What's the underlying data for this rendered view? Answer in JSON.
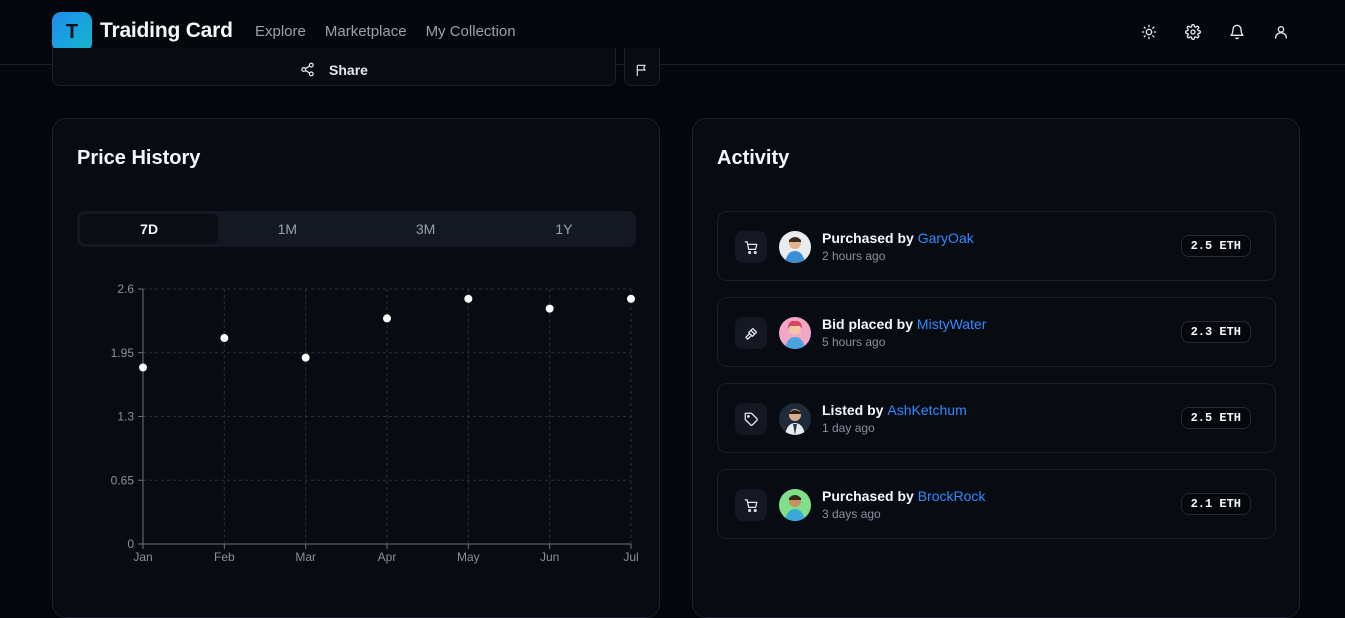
{
  "header": {
    "logo_letter": "T",
    "brand": "Traiding Card",
    "nav": [
      "Explore",
      "Marketplace",
      "My Collection"
    ],
    "icons": [
      "sun-icon",
      "gear-icon",
      "bell-icon",
      "user-icon"
    ]
  },
  "actions": {
    "share_label": "Share"
  },
  "price_history": {
    "title": "Price History",
    "ranges": [
      "7D",
      "1M",
      "3M",
      "1Y"
    ],
    "active_range": "7D"
  },
  "chart_data": {
    "type": "scatter",
    "categories": [
      "Jan",
      "Feb",
      "Mar",
      "Apr",
      "May",
      "Jun",
      "Jul"
    ],
    "values": [
      1.8,
      2.1,
      1.9,
      2.3,
      2.5,
      2.4,
      2.5
    ],
    "yticks": [
      "0",
      "0.65",
      "1.3",
      "1.95",
      "2.6"
    ],
    "ylim": [
      0,
      2.6
    ],
    "grid": true,
    "point_color": "#ffffff"
  },
  "activity": {
    "title": "Activity",
    "items": [
      {
        "action": "Purchased by",
        "user": "GaryOak",
        "time": "2 hours ago",
        "price": "2.5 ETH",
        "icon": "cart-icon"
      },
      {
        "action": "Bid placed by",
        "user": "MistyWater",
        "time": "5 hours ago",
        "price": "2.3 ETH",
        "icon": "gavel-icon"
      },
      {
        "action": "Listed by",
        "user": "AshKetchum",
        "time": "1 day ago",
        "price": "2.5 ETH",
        "icon": "tag-icon"
      },
      {
        "action": "Purchased by",
        "user": "BrockRock",
        "time": "3 days ago",
        "price": "2.1 ETH",
        "icon": "cart-icon"
      }
    ]
  },
  "colors": {
    "accent": "#2f8cff",
    "background": "#04060b",
    "card": "#080b12"
  }
}
